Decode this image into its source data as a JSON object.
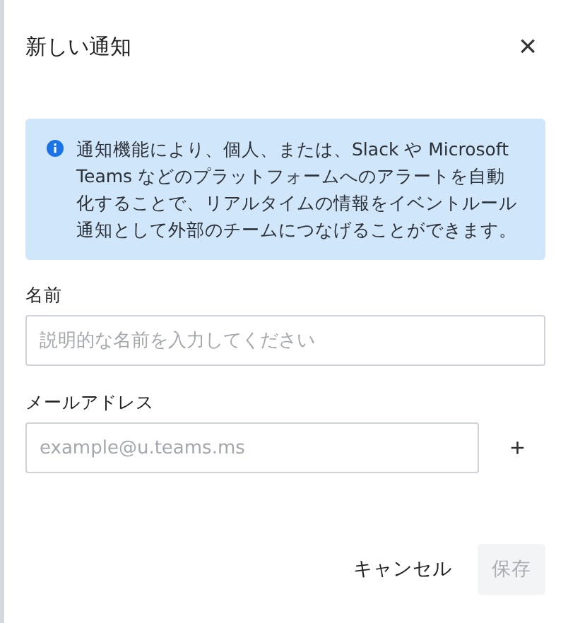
{
  "dialog": {
    "title": "新しい通知",
    "close": "×"
  },
  "info": {
    "text": "通知機能により、個人、または、Slack や Microsoft Teams などのプラットフォームへのアラートを自動化することで、リアルタイムの情報をイベントルール通知として外部のチームにつなげることができます。"
  },
  "fields": [
    {
      "label": "名前",
      "placeholder": "説明的な名前を入力してください"
    },
    {
      "label": "メールアドレス",
      "placeholder": "example@u.teams.ms",
      "add": "+"
    }
  ],
  "buttons": [
    {
      "label": "キャンセル",
      "kind": "text",
      "disabled": false
    },
    {
      "label": "保存",
      "kind": "filled",
      "disabled": true
    }
  ]
}
